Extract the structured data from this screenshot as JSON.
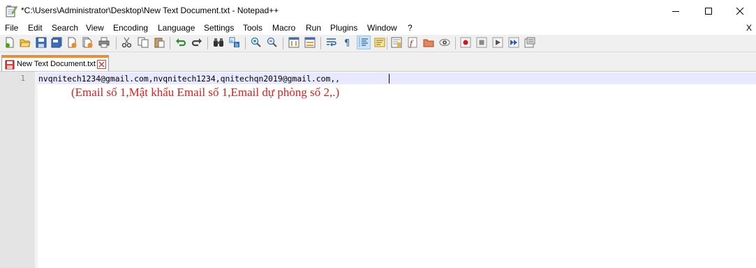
{
  "window": {
    "title": "*C:\\Users\\Administrator\\Desktop\\New Text Document.txt - Notepad++",
    "app_icon": "notepad-icon",
    "controls": [
      "minimize-icon",
      "maximize-icon",
      "close-icon"
    ]
  },
  "menu": {
    "items": [
      "File",
      "Edit",
      "Search",
      "View",
      "Encoding",
      "Language",
      "Settings",
      "Tools",
      "Macro",
      "Run",
      "Plugins",
      "Window",
      "?"
    ],
    "close_label": "X"
  },
  "toolbar": {
    "buttons": [
      "new-file-icon",
      "open-file-icon",
      "save-icon",
      "save-all-icon",
      "close-icon",
      "close-all-icon",
      "print-icon",
      "cut-icon",
      "copy-icon",
      "paste-icon",
      "undo-icon",
      "redo-icon",
      "find-icon",
      "replace-icon",
      "zoom-in-icon",
      "zoom-out-icon",
      "sync-vertical-icon",
      "sync-horizontal-icon",
      "word-wrap-icon",
      "show-all-characters-icon",
      "indent-guide-icon",
      "user-defined-language-icon",
      "document-map-icon",
      "function-list-icon",
      "folder-as-workspace-icon",
      "monitoring-icon",
      "record-macro-icon",
      "stop-recording-icon",
      "playback-macro-icon",
      "run-macro-multiple-icon",
      "save-macro-icon"
    ],
    "active": "indent-guide-icon"
  },
  "tabs": [
    {
      "label": "New Text Document.txt",
      "icon": "unsaved-file-icon",
      "close_icon": "tab-close-icon"
    }
  ],
  "editor": {
    "line_number": "1",
    "line_text": "nvqnitech1234@gmail.com,nvqnitech1234,qnitechqn2019@gmail.com,,",
    "annotation": "(Email số 1,Mật khẩu Email số 1,Email dự phòng số 2,.)",
    "annotation_color": "#e0201c"
  },
  "colors": {
    "current_line": "#e8e8ff",
    "gutter": "#e4e4e4",
    "tab_accent": "#fa8c1c"
  }
}
